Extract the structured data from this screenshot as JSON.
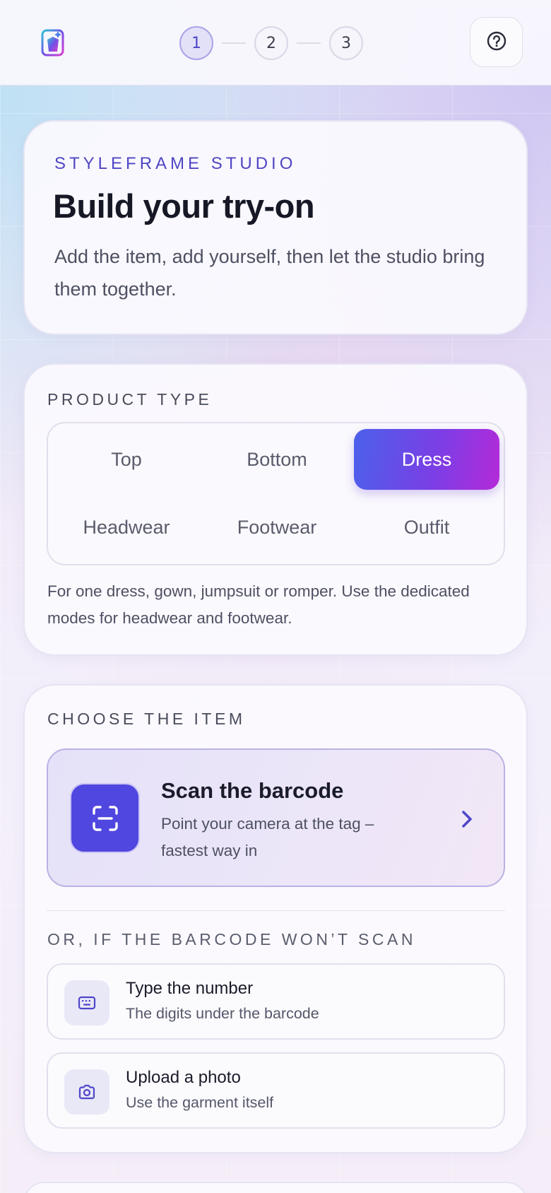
{
  "header": {
    "steps": [
      {
        "label": "1",
        "active": true
      },
      {
        "label": "2",
        "active": false
      },
      {
        "label": "3",
        "active": false
      }
    ],
    "icons": {
      "logo": "logo-icon",
      "help": "help-circle-icon"
    }
  },
  "hero": {
    "eyebrow": "STYLEFRAME STUDIO",
    "title": "Build your try-on",
    "subtitle": "Add the item, add yourself, then let the studio bring them together."
  },
  "product_type": {
    "label": "PRODUCT TYPE",
    "options": [
      "Top",
      "Bottom",
      "Dress",
      "Headwear",
      "Footwear",
      "Outfit"
    ],
    "selected": "Dress",
    "note": "For one dress, gown, jumpsuit or romper. Use the dedicated modes for headwear and footwear."
  },
  "choose_item": {
    "label": "CHOOSE THE ITEM",
    "scan": {
      "title": "Scan the barcode",
      "subtitle": "Point your camera at the tag – fastest way in",
      "icon": "barcode-scan-icon"
    },
    "fallback_label": "OR, IF THE BARCODE WON’T SCAN",
    "alternatives": [
      {
        "title": "Type the number",
        "subtitle": "The digits under the barcode",
        "icon": "keyboard-icon"
      },
      {
        "title": "Upload a photo",
        "subtitle": "Use the garment itself",
        "icon": "camera-icon"
      }
    ]
  },
  "colors": {
    "accent": "#5046e0",
    "gradient_start": "#4b61ea",
    "gradient_end": "#b42ad8"
  }
}
